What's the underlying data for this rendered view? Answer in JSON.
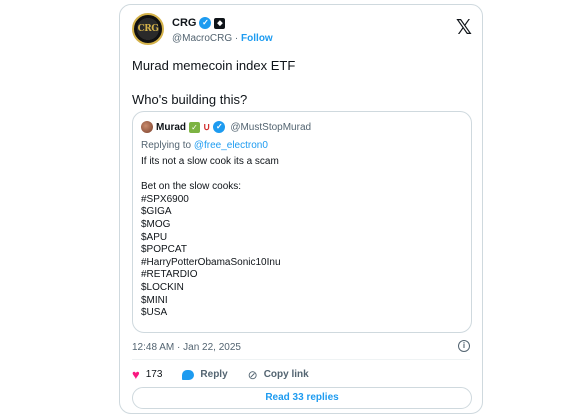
{
  "author": {
    "name": "CRG",
    "avatar_text": "CRG",
    "handle": "@MacroCRG",
    "separator": " · ",
    "follow_label": "Follow"
  },
  "icons": {
    "verified": "verified-badge-icon",
    "affiliate": "affiliate-badge-icon",
    "x_logo": "x-logo-icon",
    "heart": "heart-icon",
    "reply": "reply-icon",
    "copy_link": "link-icon",
    "info": "info-icon"
  },
  "tweet": {
    "text": "Murad memecoin index ETF\n\nWho's building this?"
  },
  "quote": {
    "name": "Murad",
    "handle": "@MustStopMurad",
    "replying_prefix": "Replying to ",
    "replying_to": "@free_electron0",
    "text": "If its not a slow cook its a scam\n\nBet on the slow cooks:\n#SPX6900\n$GIGA\n$MOG\n$APU\n$POPCAT\n#HarryPotterObamaSonic10Inu\n#RETARDIO\n$LOCKIN\n$MINI\n$USA"
  },
  "meta": {
    "timestamp": "12:48 AM · Jan 22, 2025"
  },
  "actions": {
    "likes": "173",
    "reply_label": "Reply",
    "copy_link_label": "Copy link",
    "read_replies_label": "Read 33 replies"
  },
  "colors": {
    "accent": "#1d9bf0",
    "heart": "#f91880",
    "border": "#cfd9de",
    "muted": "#536471"
  }
}
